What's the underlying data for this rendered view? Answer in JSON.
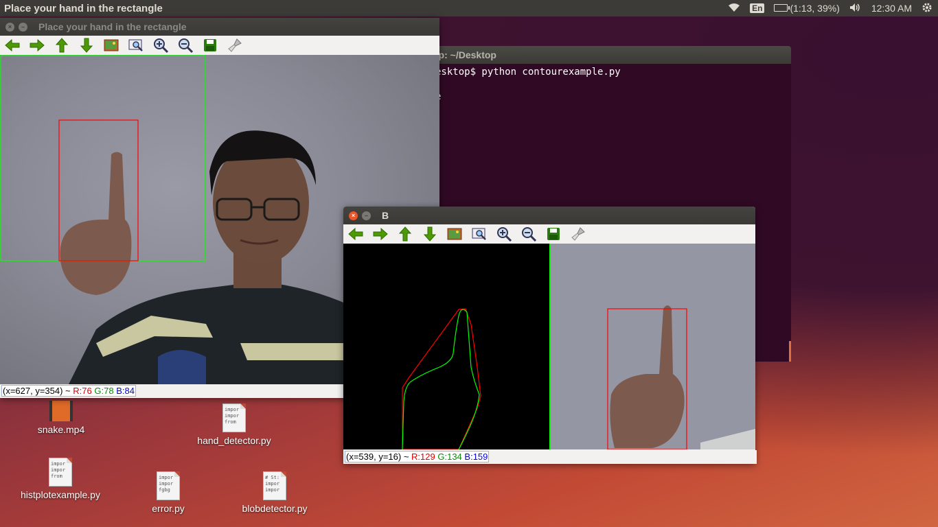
{
  "top_panel": {
    "title": "Place your hand in the rectangle",
    "language": "En",
    "battery": "(1:13, 39%)",
    "time": "12:30 AM"
  },
  "terminal": {
    "title": "op: ~/Desktop",
    "lines": [
      "esktop$ python contourexample.py",
      "",
      "e"
    ]
  },
  "window_main": {
    "title": "Place your hand in the rectangle",
    "status_coords": "(x=627, y=354) ~",
    "status_r": "R:76",
    "status_g": "G:78",
    "status_b": "B:84"
  },
  "window_b": {
    "title": "B",
    "status_coords": "(x=539, y=16) ~",
    "status_r": "R:129",
    "status_g": "G:134",
    "status_b": "B:159"
  },
  "toolbar_icons": [
    "arrow-left-icon",
    "arrow-right-icon",
    "arrow-up-icon",
    "arrow-down-icon",
    "image-icon",
    "zoom-fit-icon",
    "zoom-in-icon",
    "zoom-out-icon",
    "save-icon",
    "properties-icon"
  ],
  "desktop_icons": {
    "snake": "snake.mp4",
    "hand_detector": "hand_detector.py",
    "hand_detector_preview": [
      "impor",
      "impor",
      "from"
    ],
    "histplot": "histplotexample.py",
    "histplot_preview": [
      "impor",
      "impor",
      "from"
    ],
    "error": "error.py",
    "error_preview": [
      "impor",
      "impor",
      "fgbg"
    ],
    "blob": "blobdetector.py",
    "blob_preview": [
      "# St:",
      "impor",
      "impor"
    ]
  },
  "colors": {
    "panel": "#3c3b37",
    "terminal_bg": "#300a24",
    "close_active": "#e8562a",
    "roi_green": "#00ff00",
    "roi_red": "#ff0000"
  }
}
